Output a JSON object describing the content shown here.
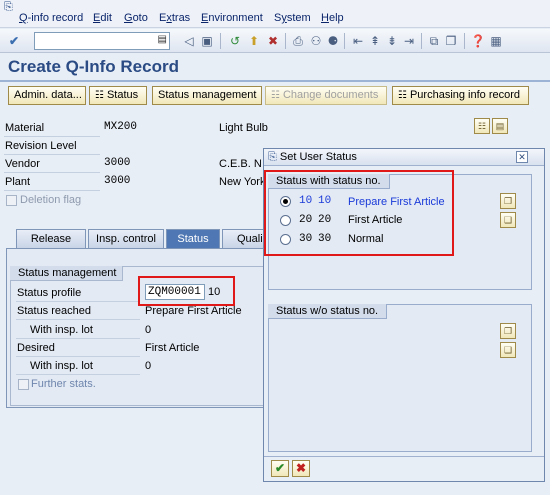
{
  "menu": {
    "items": [
      "Q-info record",
      "Edit",
      "Goto",
      "Extras",
      "Environment",
      "System",
      "Help"
    ],
    "underline": [
      "Q",
      "E",
      "G",
      "x",
      "E",
      "y",
      "H"
    ]
  },
  "toolbar": {
    "command_value": "",
    "icons": [
      "enter-icon",
      "save-icon",
      "back-icon",
      "exit-icon",
      "cancel-icon",
      "print-icon",
      "find-icon",
      "find-next-icon",
      "first-page-icon",
      "prev-page-icon",
      "next-page-icon",
      "last-page-icon",
      "new-session-icon",
      "shortcut-icon",
      "help-icon",
      "layout-icon"
    ]
  },
  "page": {
    "title": "Create Q-Info Record"
  },
  "app_toolbar": {
    "admin_data": "Admin. data...",
    "status": "Status",
    "status_management": "Status management",
    "change_documents": "Change documents",
    "purchasing_info_record": "Purchasing info record"
  },
  "header": {
    "material_label": "Material",
    "material_value": "MX200",
    "material_desc": "Light Bulb",
    "revision_label": "Revision Level",
    "vendor_label": "Vendor",
    "vendor_value": "3000",
    "vendor_desc": "C.E.B. N",
    "plant_label": "Plant",
    "plant_value": "3000",
    "plant_desc": "New York",
    "deletion_flag": "Deletion flag"
  },
  "tabs": [
    "Release",
    "Insp. control",
    "Status",
    "Quali"
  ],
  "status_mgmt": {
    "group_title": "Status management",
    "profile_label": "Status profile",
    "profile_value": "ZQM00001",
    "profile_number": "10",
    "reached_label": "Status reached",
    "reached_value": "Prepare First Article",
    "with_lot_label": "With insp. lot",
    "with_lot_value": "0",
    "desired_label": "Desired",
    "desired_value": "First Article",
    "desired_lot_label": "With insp. lot",
    "desired_lot_value": "0",
    "further_stats": "Further stats."
  },
  "dialog": {
    "title": "Set User Status",
    "section1_title": "Status with status no.",
    "statuses": [
      {
        "num": "10",
        "code": "10",
        "text": "Prepare First Article",
        "selected": true
      },
      {
        "num": "20",
        "code": "20",
        "text": "First Article",
        "selected": false
      },
      {
        "num": "30",
        "code": "30",
        "text": "Normal",
        "selected": false
      }
    ],
    "section2_title": "Status w/o status no."
  },
  "colors": {
    "accent": "#2a4b84",
    "highlight_text": "#1a3ad8",
    "annotation_red": "#e01818",
    "active_tab": "#4f77b3"
  }
}
